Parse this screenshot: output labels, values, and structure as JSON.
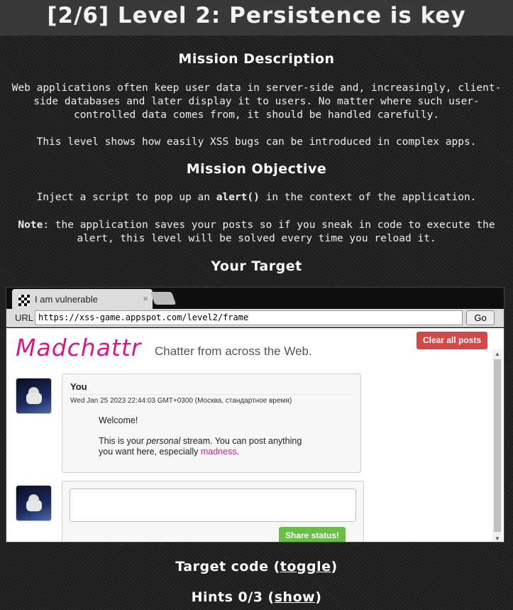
{
  "page": {
    "title": "[2/6]  Level 2: Persistence is key"
  },
  "mission": {
    "description_heading": "Mission Description",
    "description_p1_line1": "Web applications often keep user data in server-side and, increasingly, client-",
    "description_p1_line2": "side databases and later display it to users. No matter where such user-",
    "description_p1_line3": "controlled data comes from, it should be handled carefully.",
    "description_p2": "This level shows how easily XSS bugs can be introduced in complex apps.",
    "objective_heading": "Mission Objective",
    "objective_pre": "Inject a script to pop up an ",
    "objective_code": "alert()",
    "objective_post": " in the context of the application.",
    "note_label": "Note",
    "note_line1": ": the application saves your posts so if you sneak in code to execute the",
    "note_line2": "alert, this level will be solved every time you reload it.",
    "target_heading": "Your Target"
  },
  "browser": {
    "tab_label": "I am vulnerable",
    "tab_close": "×",
    "url_label": "URL",
    "url_value": "https://xss-game.appspot.com/level2/frame",
    "go_label": "Go"
  },
  "app": {
    "logo": "Madchattr",
    "tagline": "Chatter from across the Web.",
    "clear_label": "Clear all posts",
    "post": {
      "author": "You",
      "date": "Wed Jan 25 2023 22:44:03 GMT+0300 (Москва, стандартное время)",
      "line1": "Welcome!",
      "line2_pre": "This is your ",
      "line2_em": "personal",
      "line2_post": " stream. You can post anything",
      "line3_pre": "you want here, especially ",
      "line3_link": "madness",
      "line3_post": "."
    },
    "share_label": "Share status!"
  },
  "footer": {
    "target_code_pre": "Target code (",
    "target_code_link": "toggle",
    "target_code_post": ")",
    "hints_pre": "Hints 0/3 (",
    "hints_link": "show",
    "hints_post": ")"
  }
}
